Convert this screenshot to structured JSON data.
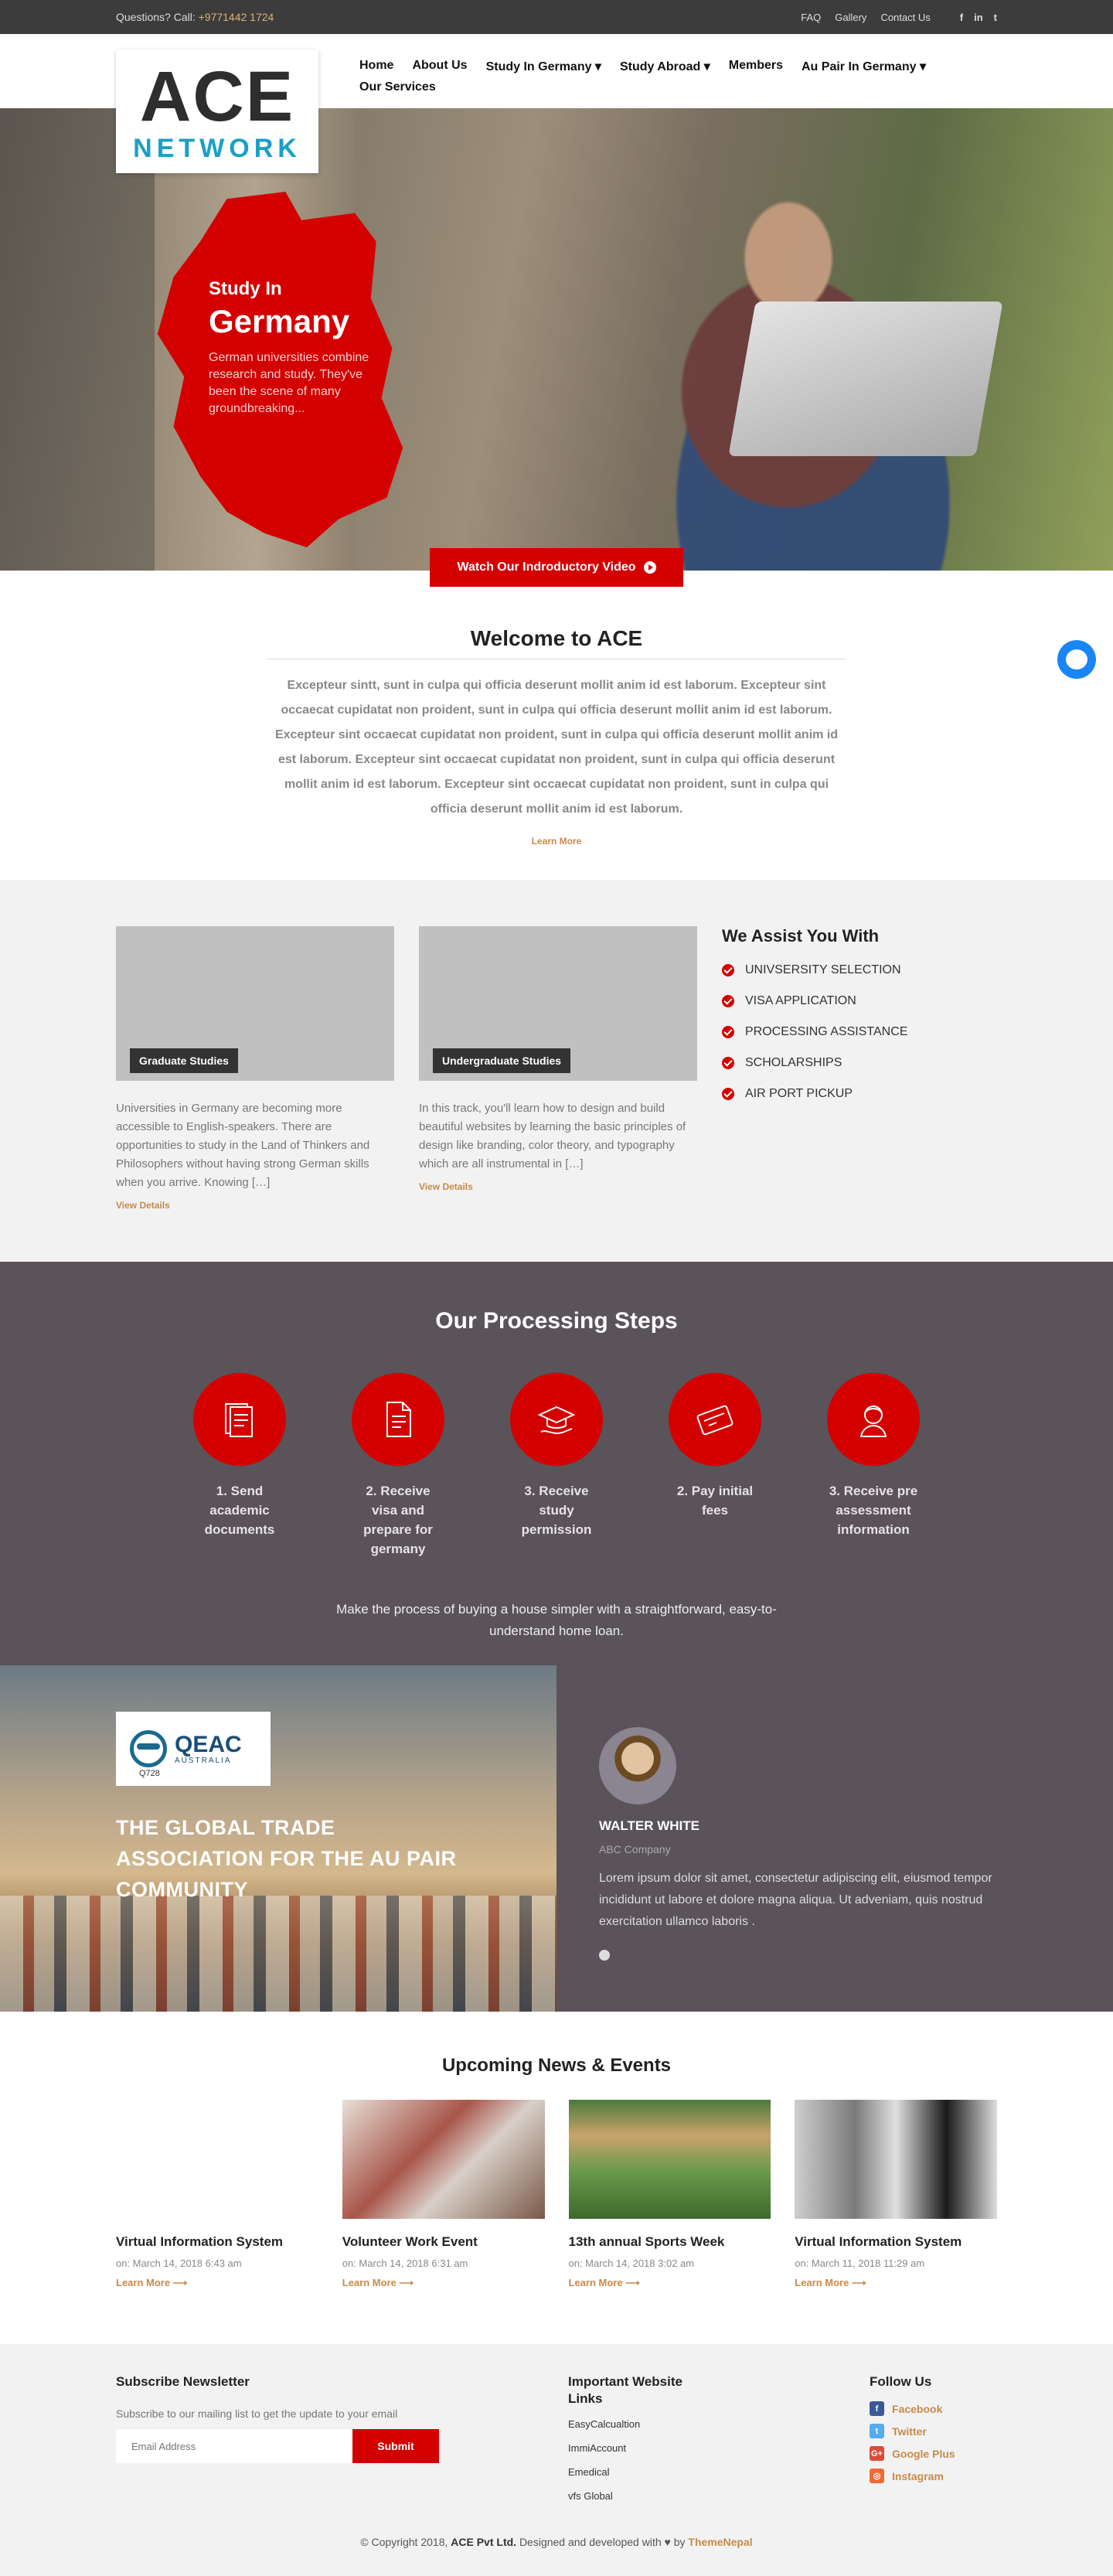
{
  "topbar": {
    "question": "Questions? Call:",
    "phone": "+9771442 1724",
    "links": [
      "FAQ",
      "Gallery",
      "Contact Us"
    ],
    "social": [
      "f",
      "in",
      "t"
    ]
  },
  "logo": {
    "ace": "ACE",
    "network": "NETWORK"
  },
  "nav": [
    "Home",
    "About Us",
    "Study In Germany ▾",
    "Study Abroad ▾",
    "Members",
    "Au Pair In Germany ▾",
    "Our Services"
  ],
  "hero": {
    "line1": "Study In",
    "line2": "Germany",
    "desc": "German universities combine research and study. They've been the scene of many groundbreaking...",
    "video_button": "Watch Our Indroductory Video"
  },
  "welcome": {
    "title": "Welcome to ACE",
    "body": "Excepteur sintt, sunt in culpa qui officia deserunt mollit anim id est laborum. Excepteur sint occaecat cupidatat non proident, sunt in culpa qui officia deserunt mollit anim id est laborum. Excepteur sint occaecat cupidatat non proident, sunt in culpa qui officia deserunt mollit anim id est laborum. Excepteur sint occaecat cupidatat non proident, sunt in culpa qui officia deserunt mollit anim id est laborum. Excepteur sint occaecat cupidatat non proident, sunt in culpa qui officia deserunt mollit anim id est laborum.",
    "learn_more": "Learn More"
  },
  "studies": {
    "cards": [
      {
        "tag": "Graduate Studies",
        "text": "Universities in Germany are becoming more accessible to English-speakers. There are opportunities to study in the Land of Thinkers and Philosophers without having strong German skills when you arrive. Knowing […]",
        "link": "View Details"
      },
      {
        "tag": "Undergraduate Studies",
        "text": "In this track, you'll learn how to design and build beautiful websites by learning the basic principles of design like branding, color theory, and typography which are all instrumental in […]",
        "link": "View Details"
      }
    ],
    "assist_title": "We Assist You With",
    "assist_items": [
      "UNIVSERSITY SELECTION",
      "VISA APPLICATION",
      "PROCESSING ASSISTANCE",
      "SCHOLARSHIPS",
      "AIR PORT PICKUP"
    ]
  },
  "steps": {
    "title": "Our Processing Steps",
    "items": [
      {
        "label": "1. Send academic documents",
        "icon": "documents-icon"
      },
      {
        "label": "2. Receive visa and prepare for germany",
        "icon": "file-icon"
      },
      {
        "label": "3. Receive study permission",
        "icon": "graduation-cap-icon"
      },
      {
        "label": "2. Pay initial fees",
        "icon": "credit-card-icon"
      },
      {
        "label": "3. Receive pre assessment information",
        "icon": "person-icon"
      }
    ],
    "caption": "Make the process of buying a house simpler with a straightforward, easy-to-understand home loan."
  },
  "partner": {
    "logo_word": "QEAC",
    "logo_sub": "AUSTRALIA",
    "logo_code": "Q728",
    "headline": "THE GLOBAL TRADE ASSOCIATION FOR THE AU PAIR COMMUNITY"
  },
  "testimonial": {
    "name": "WALTER WHITE",
    "company": "ABC Company",
    "quote": "Lorem ipsum dolor sit amet, consectetur adipiscing elit, eiusmod tempor incididunt ut labore et dolore magna aliqua. Ut adveniam, quis nostrud exercitation ullamco laboris ."
  },
  "news": {
    "title": "Upcoming News & Events",
    "items": [
      {
        "title": "Virtual Information System",
        "date": "on: March 14, 2018 6:43 am",
        "link": "Learn More ⟶",
        "image": ""
      },
      {
        "title": "Volunteer Work Event",
        "date": "on: March 14, 2018 6:31 am",
        "link": "Learn More ⟶",
        "image": "img-chair"
      },
      {
        "title": "13th annual Sports Week",
        "date": "on: March 14, 2018 3:02 am",
        "link": "Learn More ⟶",
        "image": "img-field"
      },
      {
        "title": "Virtual Information System",
        "date": "on: March 11, 2018 11:29 am",
        "link": "Learn More ⟶",
        "image": "img-clothes"
      }
    ]
  },
  "footer": {
    "newsletter_title": "Subscribe Newsletter",
    "newsletter_text": "Subscribe to our mailing list to get the update to your email",
    "email_placeholder": "Email Address",
    "submit": "Submit",
    "links_title": "Important Website Links",
    "links": [
      "EasyCalcualtion",
      "ImmiAccount",
      "Emedical",
      "vfs Global"
    ],
    "follow_title": "Follow Us",
    "follow": [
      {
        "label": "Facebook",
        "color": "#3b5998",
        "glyph": "f"
      },
      {
        "label": "Twitter",
        "color": "#55acee",
        "glyph": "t"
      },
      {
        "label": "Google Plus",
        "color": "#dd4b39",
        "glyph": "G+"
      },
      {
        "label": "Instagram",
        "color": "#f06a35",
        "glyph": "◎"
      }
    ],
    "copy_pre": "© Copyright 2018,",
    "copy_company": "ACE Pvt Ltd.",
    "copy_mid": "Designed and developed with ♥ by",
    "copy_dev": "ThemeNepal"
  },
  "colors": {
    "accent": "#d40000",
    "dark": "#5a5359",
    "link": "#c88a4a"
  }
}
